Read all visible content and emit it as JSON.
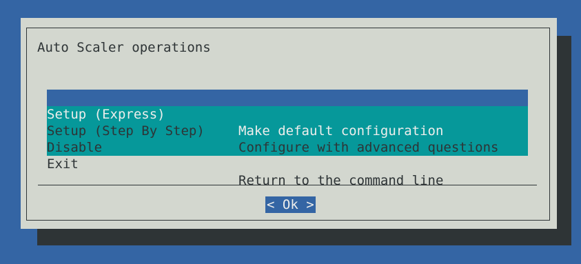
{
  "dialog": {
    "title": "Auto Scaler operations",
    "menu_items": [
      {
        "tag": "Setup (Express)",
        "description": "Make default configuration",
        "selected": true
      },
      {
        "tag": "Setup (Step By Step)",
        "description": "Configure with advanced questions",
        "selected": false
      },
      {
        "tag": "Disable",
        "description": "",
        "selected": false
      },
      {
        "tag": "Exit",
        "description": "Return to the command line",
        "selected": false
      }
    ],
    "ok_button": "< Ok >"
  },
  "colors": {
    "background": "#3465a4",
    "dialog": "#d3d7cf",
    "menu": "#06989a",
    "selection": "#3465a4",
    "shadow": "#2e3436"
  }
}
